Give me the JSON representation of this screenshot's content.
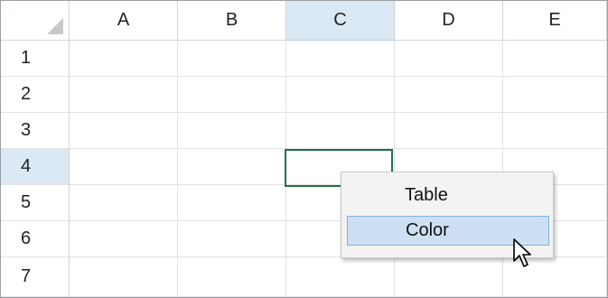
{
  "spreadsheet": {
    "columns": [
      "A",
      "B",
      "C",
      "D",
      "E"
    ],
    "rows": [
      "1",
      "2",
      "3",
      "4",
      "5",
      "6",
      "7"
    ],
    "active_column": "C",
    "active_row": "4"
  },
  "context_menu": {
    "items": [
      {
        "label": "Table"
      },
      {
        "label": "Color"
      }
    ],
    "hovered_item": "Color"
  },
  "icons": {
    "corner": "select-all-triangle-icon",
    "cursor": "mouse-pointer-icon"
  },
  "colors": {
    "selection_border": "#217346",
    "header_highlight": "#dbe9f5",
    "menu_hover": "#cddff2",
    "menu_hover_border": "#7fb2e6"
  }
}
